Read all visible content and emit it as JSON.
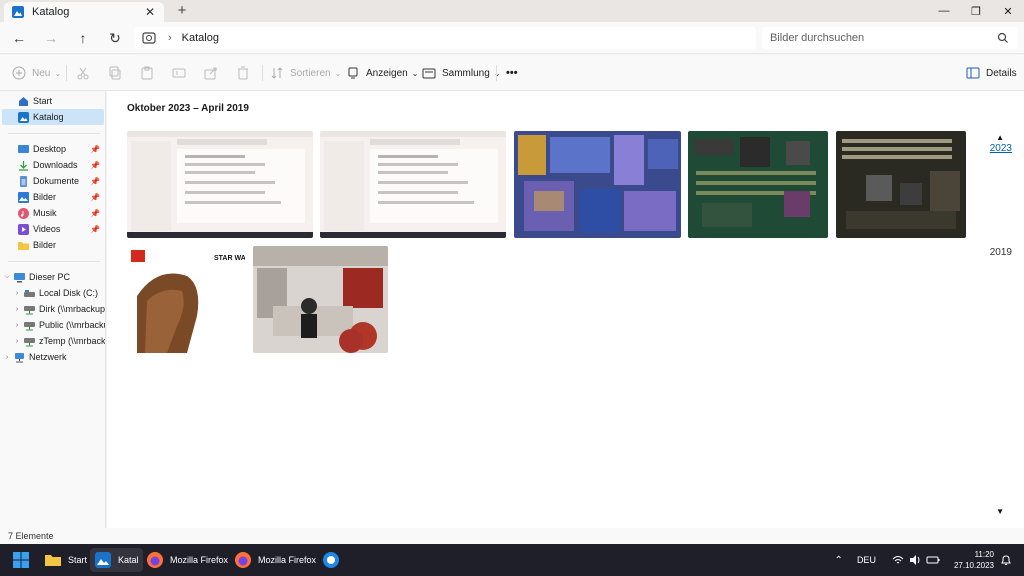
{
  "window": {
    "tab_title": "Katalog",
    "new_tab": "+",
    "controls": {
      "minimize": "—",
      "maximize": "❐",
      "close": "✕"
    }
  },
  "navigation": {
    "back": "←",
    "forward": "→",
    "up": "↑",
    "refresh": "↻",
    "breadcrumb": "Katalog",
    "search_placeholder": "Bilder durchsuchen"
  },
  "toolbar": {
    "new_label": "Neu",
    "sort_label": "Sortieren",
    "view_label": "Anzeigen",
    "collection_label": "Sammlung",
    "more_label": "•••",
    "details_label": "Details"
  },
  "sidebar": {
    "home": "Start",
    "catalog": "Katalog",
    "quick_access": [
      {
        "label": "Desktop",
        "icon": "desktop-icon"
      },
      {
        "label": "Downloads",
        "icon": "download-icon"
      },
      {
        "label": "Dokumente",
        "icon": "documents-icon"
      },
      {
        "label": "Bilder",
        "icon": "pictures-icon"
      },
      {
        "label": "Musik",
        "icon": "music-icon"
      },
      {
        "label": "Videos",
        "icon": "videos-icon"
      },
      {
        "label": "Bilder",
        "icon": "folder-icon"
      }
    ],
    "this_pc": "Dieser PC",
    "drives": [
      "Local Disk (C:)",
      "Dirk (\\\\mrbackup) (",
      "Public (\\\\mrbackup",
      "zTemp (\\\\mrbackup"
    ],
    "network": "Netzwerk"
  },
  "main": {
    "group_title": "Oktober 2023 – April 2019",
    "timeline_years": [
      "2023",
      "2019"
    ]
  },
  "status": {
    "item_count": "7 Elemente"
  },
  "taskbar": {
    "start": "Start",
    "explorer": "Katal",
    "firefox_1": "Mozilla Firefox",
    "firefox_2": "Mozilla Firefox",
    "language": "DEU",
    "time": "11:20",
    "date": "27.10.2023"
  },
  "colors": {
    "accent": "#005fb8",
    "selected": "#cce4f7",
    "taskbar": "#1f1f2a"
  }
}
